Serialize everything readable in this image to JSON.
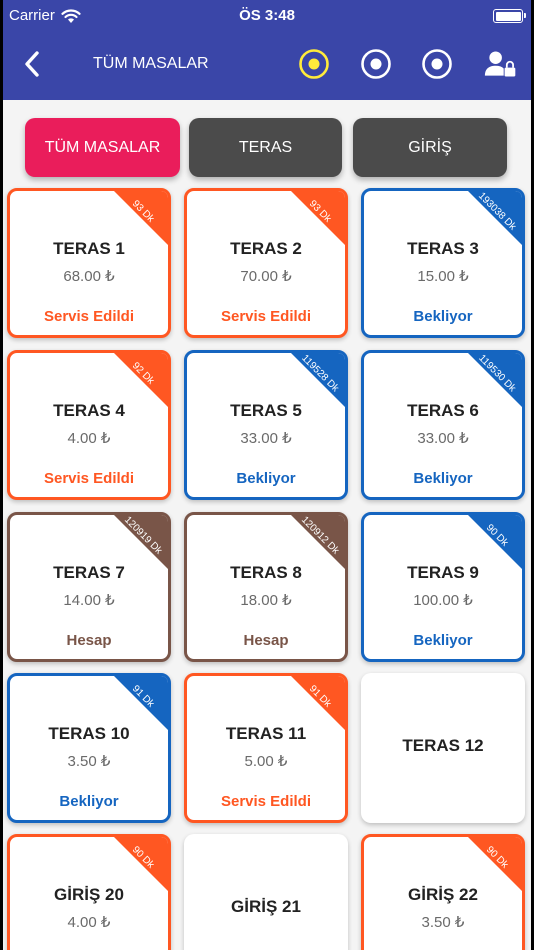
{
  "status_bar": {
    "carrier": "Carrier",
    "time": "ÖS 3:48"
  },
  "nav": {
    "title": "TÜM MASALAR",
    "icons": [
      "chevron-left-icon",
      "radio-target-icon-active",
      "radio-target-icon",
      "radio-target-icon",
      "user-lock-icon"
    ]
  },
  "filters": [
    {
      "label": "TÜM MASALAR",
      "active": true
    },
    {
      "label": "TERAS",
      "active": false
    },
    {
      "label": "GİRİŞ",
      "active": false
    }
  ],
  "colors": {
    "served": "#ff5722",
    "waiting": "#1565c0",
    "bill": "#795548",
    "header": "#3a46a8",
    "filter_active": "#ea1d5b",
    "filter_inactive": "#4b4b4b",
    "active_icon": "#ffeb3b"
  },
  "tables": [
    {
      "name": "TERAS 1",
      "price": "68.00 ₺",
      "status": "Servis Edildi",
      "badge": "93 Dk",
      "state": "served"
    },
    {
      "name": "TERAS 2",
      "price": "70.00 ₺",
      "status": "Servis Edildi",
      "badge": "93 Dk",
      "state": "served"
    },
    {
      "name": "TERAS 3",
      "price": "15.00 ₺",
      "status": "Bekliyor",
      "badge": "193038 Dk",
      "state": "waiting"
    },
    {
      "name": "TERAS 4",
      "price": "4.00 ₺",
      "status": "Servis Edildi",
      "badge": "92 Dk",
      "state": "served"
    },
    {
      "name": "TERAS 5",
      "price": "33.00 ₺",
      "status": "Bekliyor",
      "badge": "119528 Dk",
      "state": "waiting"
    },
    {
      "name": "TERAS 6",
      "price": "33.00 ₺",
      "status": "Bekliyor",
      "badge": "119530 Dk",
      "state": "waiting"
    },
    {
      "name": "TERAS 7",
      "price": "14.00 ₺",
      "status": "Hesap",
      "badge": "120919 Dk",
      "state": "bill"
    },
    {
      "name": "TERAS 8",
      "price": "18.00 ₺",
      "status": "Hesap",
      "badge": "120912 Dk",
      "state": "bill"
    },
    {
      "name": "TERAS 9",
      "price": "100.00 ₺",
      "status": "Bekliyor",
      "badge": "90 Dk",
      "state": "waiting"
    },
    {
      "name": "TERAS 10",
      "price": "3.50 ₺",
      "status": "Bekliyor",
      "badge": "91 Dk",
      "state": "waiting"
    },
    {
      "name": "TERAS 11",
      "price": "5.00 ₺",
      "status": "Servis Edildi",
      "badge": "91 Dk",
      "state": "served"
    },
    {
      "name": "TERAS 12",
      "price": "",
      "status": "",
      "badge": "",
      "state": "empty"
    },
    {
      "name": "GİRİŞ 20",
      "price": "4.00 ₺",
      "status": "",
      "badge": "90 Dk",
      "state": "served"
    },
    {
      "name": "GİRİŞ 21",
      "price": "",
      "status": "",
      "badge": "",
      "state": "empty"
    },
    {
      "name": "GİRİŞ 22",
      "price": "3.50 ₺",
      "status": "",
      "badge": "90 Dk",
      "state": "served"
    }
  ]
}
